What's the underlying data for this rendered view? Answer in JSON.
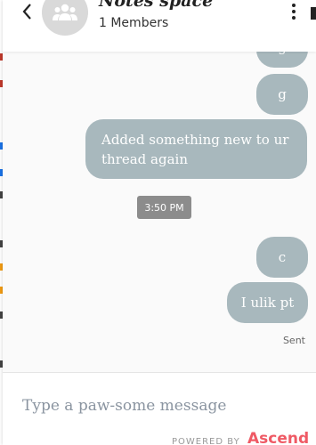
{
  "header": {
    "title": "Notes space",
    "member_count": "1 Members",
    "back_icon": "chevron-left-icon",
    "menu_icon": "more-vertical-icon",
    "avatar_icon": "group-icon"
  },
  "messages": [
    {
      "text": "g"
    },
    {
      "text": "g"
    },
    {
      "text": "Added something new to ur thread again"
    },
    {
      "text": "c"
    },
    {
      "text": "I ulik pt"
    }
  ],
  "timestamp": "3:50 PM",
  "status": "Sent",
  "composer": {
    "placeholder": "Type a paw-some message"
  },
  "footer": {
    "powered_by": "POWERED BY",
    "brand": "Ascend"
  },
  "colors": {
    "bubble": "#a8b8bd",
    "timestamp_bg": "#8c8c8c",
    "brand": "#ef5a65"
  }
}
